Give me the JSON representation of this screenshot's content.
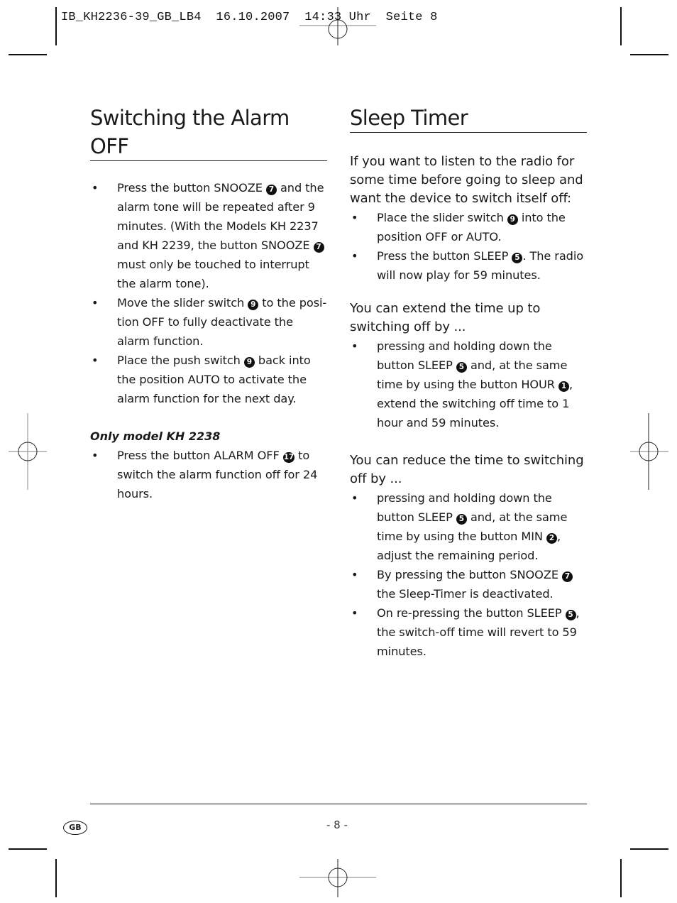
{
  "print_slug": "IB_KH2236-39_GB_LB4  16.10.2007  14:33 Uhr  Seite 8",
  "left_section": {
    "title": "Switching the Alarm OFF",
    "bullets": [
      {
        "parts": [
          "Press the button SNOOZE ",
          "7",
          " and the alarm tone will be repeated after 9 minutes. (With the Models KH 2237 and KH 2239, the button SNOOZE ",
          "7",
          " must only be touched to interrupt the alarm tone)."
        ]
      },
      {
        "parts": [
          "Move the slider switch ",
          "9",
          " to the posi-tion OFF to fully deactivate the alarm function."
        ]
      },
      {
        "parts": [
          "Place the push switch ",
          "9",
          " back into the position AUTO to activate the alarm function for the next day."
        ]
      }
    ],
    "model_heading": "Only model KH 2238",
    "model_bullets": [
      {
        "parts": [
          "Press the button ALARM OFF ",
          "17",
          " to switch the alarm function off for 24 hours."
        ]
      }
    ]
  },
  "right_section": {
    "title": "Sleep Timer",
    "intro": "If you want to listen to the radio for some time before going to sleep and want the device to switch itself off:",
    "intro_bullets": [
      {
        "parts": [
          "Place the slider switch ",
          "9",
          " into the position OFF or AUTO."
        ]
      },
      {
        "parts": [
          "Press the button SLEEP ",
          "5",
          ". The radio will now play for 59 minutes."
        ]
      }
    ],
    "extend_heading": "You can extend the time up to switching off by ...",
    "extend_bullets": [
      {
        "parts": [
          "pressing and holding down the button SLEEP ",
          "5",
          " and, at the same time by using the button HOUR ",
          "1",
          ", extend the switching off time to 1 hour and 59 minutes."
        ]
      }
    ],
    "reduce_heading": "You can reduce the time to switching off by ...",
    "reduce_bullets": [
      {
        "parts": [
          "pressing and holding down the button SLEEP ",
          "5",
          " and, at the same time by using the button MIN ",
          "2",
          ", adjust the remaining period."
        ]
      },
      {
        "parts": [
          "By pressing the button SNOOZE ",
          "7",
          " the Sleep-Timer is deactivated."
        ]
      },
      {
        "parts": [
          "On re-pressing the button SLEEP ",
          "5",
          ", the switch-off time will revert to 59 minutes."
        ]
      }
    ]
  },
  "footer": {
    "language_badge": "GB",
    "page_number": "- 8 -"
  }
}
